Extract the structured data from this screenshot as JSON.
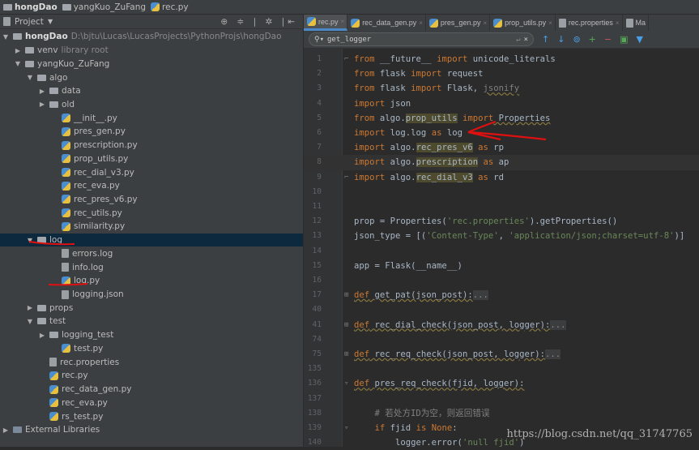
{
  "nav": {
    "crumbs": [
      "hongDao",
      "yangKuo_ZuFang",
      "rec.py"
    ]
  },
  "sidebar": {
    "title": "Project",
    "tools": "⊕ ≑ | ✲ |⇤",
    "tree": [
      {
        "label": "hongDao",
        "hint": "D:\\bjtu\\Lucas\\LucasProjects\\PythonProjs\\hongDao",
        "depth": 0,
        "type": "folder",
        "open": true,
        "bold": true
      },
      {
        "label": "venv",
        "hint": "library root",
        "depth": 1,
        "type": "folder",
        "open": false
      },
      {
        "label": "yangKuo_ZuFang",
        "depth": 1,
        "type": "folder",
        "open": true
      },
      {
        "label": "algo",
        "depth": 2,
        "type": "folder",
        "open": true
      },
      {
        "label": "data",
        "depth": 3,
        "type": "folder",
        "open": false
      },
      {
        "label": "old",
        "depth": 3,
        "type": "folder",
        "open": false
      },
      {
        "label": "__init__.py",
        "depth": 4,
        "type": "py"
      },
      {
        "label": "pres_gen.py",
        "depth": 4,
        "type": "py"
      },
      {
        "label": "prescription.py",
        "depth": 4,
        "type": "py"
      },
      {
        "label": "prop_utils.py",
        "depth": 4,
        "type": "py"
      },
      {
        "label": "rec_dial_v3.py",
        "depth": 4,
        "type": "py"
      },
      {
        "label": "rec_eva.py",
        "depth": 4,
        "type": "py"
      },
      {
        "label": "rec_pres_v6.py",
        "depth": 4,
        "type": "py"
      },
      {
        "label": "rec_utils.py",
        "depth": 4,
        "type": "py"
      },
      {
        "label": "similarity.py",
        "depth": 4,
        "type": "py"
      },
      {
        "label": "log",
        "depth": 2,
        "type": "folder",
        "open": true,
        "selected": true
      },
      {
        "label": "errors.log",
        "depth": 4,
        "type": "file"
      },
      {
        "label": "info.log",
        "depth": 4,
        "type": "file"
      },
      {
        "label": "log.py",
        "depth": 4,
        "type": "py"
      },
      {
        "label": "logging.json",
        "depth": 4,
        "type": "file"
      },
      {
        "label": "props",
        "depth": 2,
        "type": "folder",
        "open": false
      },
      {
        "label": "test",
        "depth": 2,
        "type": "folder",
        "open": true
      },
      {
        "label": "logging_test",
        "depth": 3,
        "type": "folder",
        "open": false
      },
      {
        "label": "test.py",
        "depth": 4,
        "type": "py"
      },
      {
        "label": "rec.properties",
        "depth": 3,
        "type": "file"
      },
      {
        "label": "rec.py",
        "depth": 3,
        "type": "py"
      },
      {
        "label": "rec_data_gen.py",
        "depth": 3,
        "type": "py"
      },
      {
        "label": "rec_eva.py",
        "depth": 3,
        "type": "py"
      },
      {
        "label": "rs_test.py",
        "depth": 3,
        "type": "py"
      },
      {
        "label": "External Libraries",
        "depth": 0,
        "type": "lib",
        "open": false
      }
    ]
  },
  "tabs": [
    {
      "label": "rec.py",
      "active": true
    },
    {
      "label": "rec_data_gen.py"
    },
    {
      "label": "pres_gen.py"
    },
    {
      "label": "prop_utils.py"
    },
    {
      "label": "rec.properties"
    },
    {
      "label": "Ma"
    }
  ],
  "search": {
    "value": "get_logger",
    "close": "×"
  },
  "code": [
    {
      "n": "1",
      "fold": "⌐",
      "t": [
        [
          "from",
          "kw"
        ],
        [
          " __future__ ",
          "df"
        ],
        [
          "import",
          "kw"
        ],
        [
          " unicode_literals",
          "df"
        ]
      ]
    },
    {
      "n": "2",
      "t": [
        [
          "from",
          "kw"
        ],
        [
          " flask ",
          "df"
        ],
        [
          "import",
          "kw"
        ],
        [
          " request",
          "df"
        ]
      ]
    },
    {
      "n": "3",
      "t": [
        [
          "from",
          "kw"
        ],
        [
          " flask ",
          "df"
        ],
        [
          "import",
          "kw"
        ],
        [
          " Flask, ",
          "df"
        ],
        [
          "jsonify",
          "cm ul"
        ]
      ]
    },
    {
      "n": "4",
      "t": [
        [
          "import",
          "kw"
        ],
        [
          " json",
          "df"
        ]
      ]
    },
    {
      "n": "5",
      "t": [
        [
          "from",
          "kw"
        ],
        [
          " algo.",
          "df"
        ],
        [
          "prop_utils",
          "df hl"
        ],
        [
          " import",
          "kw"
        ],
        [
          " Properties",
          "df ul"
        ]
      ]
    },
    {
      "n": "6",
      "t": [
        [
          "import",
          "kw"
        ],
        [
          " log.log ",
          "df"
        ],
        [
          "as",
          "kw"
        ],
        [
          " log",
          "df"
        ]
      ]
    },
    {
      "n": "7",
      "t": [
        [
          "import",
          "kw"
        ],
        [
          " algo.",
          "df"
        ],
        [
          "rec_pres_v6",
          "df hl"
        ],
        [
          " as",
          "kw"
        ],
        [
          " rp",
          "df"
        ]
      ]
    },
    {
      "n": "8",
      "cur": true,
      "t": [
        [
          "import",
          "kw"
        ],
        [
          " algo.",
          "df"
        ],
        [
          "prescription",
          "df hl"
        ],
        [
          " as",
          "kw"
        ],
        [
          " ap",
          "df"
        ]
      ]
    },
    {
      "n": "9",
      "fold": "⌐",
      "t": [
        [
          "import",
          "kw"
        ],
        [
          " algo.",
          "df"
        ],
        [
          "rec_dial_v3",
          "df hl"
        ],
        [
          " as",
          "kw"
        ],
        [
          " rd",
          "df"
        ]
      ]
    },
    {
      "n": "10",
      "t": []
    },
    {
      "n": "11",
      "t": []
    },
    {
      "n": "12",
      "t": [
        [
          "prop = Properties(",
          "df"
        ],
        [
          "'rec.properties'",
          "st"
        ],
        [
          ").getProperties()",
          "df"
        ]
      ]
    },
    {
      "n": "13",
      "t": [
        [
          "json_type = [(",
          "df"
        ],
        [
          "'Content-Type'",
          "st"
        ],
        [
          ", ",
          "df"
        ],
        [
          "'application/json;charset=utf-8'",
          "st"
        ],
        [
          ")]",
          "df"
        ]
      ]
    },
    {
      "n": "14",
      "t": []
    },
    {
      "n": "15",
      "t": [
        [
          "app = Flask(__name__)",
          "df"
        ]
      ]
    },
    {
      "n": "16",
      "t": []
    },
    {
      "n": "17",
      "fold": "⊞",
      "t": [
        [
          "def",
          "kw ul"
        ],
        [
          " get_pat(json_post):",
          "df ul"
        ],
        [
          "...",
          "fd"
        ]
      ]
    },
    {
      "n": "40",
      "t": []
    },
    {
      "n": "41",
      "fold": "⊞",
      "t": [
        [
          "def",
          "kw ul"
        ],
        [
          " rec_dial_check(json_post, logger):",
          "df ul"
        ],
        [
          "...",
          "fd"
        ]
      ]
    },
    {
      "n": "74",
      "t": []
    },
    {
      "n": "75",
      "fold": "⊞",
      "t": [
        [
          "def",
          "kw ul"
        ],
        [
          " rec_req_check(json_post, logger):",
          "df ul"
        ],
        [
          "...",
          "fd"
        ]
      ]
    },
    {
      "n": "135",
      "t": []
    },
    {
      "n": "136",
      "fold": "▿",
      "t": [
        [
          "def",
          "kw ul"
        ],
        [
          " pres_req_check(fjid, logger):",
          "df ul"
        ]
      ]
    },
    {
      "n": "137",
      "t": []
    },
    {
      "n": "138",
      "t": [
        [
          "    # 若处方ID为空，则返回错误",
          "cm"
        ]
      ]
    },
    {
      "n": "139",
      "fold": "▿",
      "t": [
        [
          "    if",
          "kw"
        ],
        [
          " fjid ",
          "df"
        ],
        [
          "is None",
          "kw"
        ],
        [
          ":",
          "df"
        ]
      ]
    },
    {
      "n": "140",
      "t": [
        [
          "        logger.error(",
          "df"
        ],
        [
          "'null fjid'",
          "st"
        ],
        [
          ")",
          "df"
        ]
      ]
    }
  ],
  "watermark": "https://blog.csdn.net/qq_31747765",
  "colors": {
    "annotation": "#e01010",
    "keyword": "#cc7832",
    "string": "#6a8759",
    "selection": "#0d293e"
  }
}
